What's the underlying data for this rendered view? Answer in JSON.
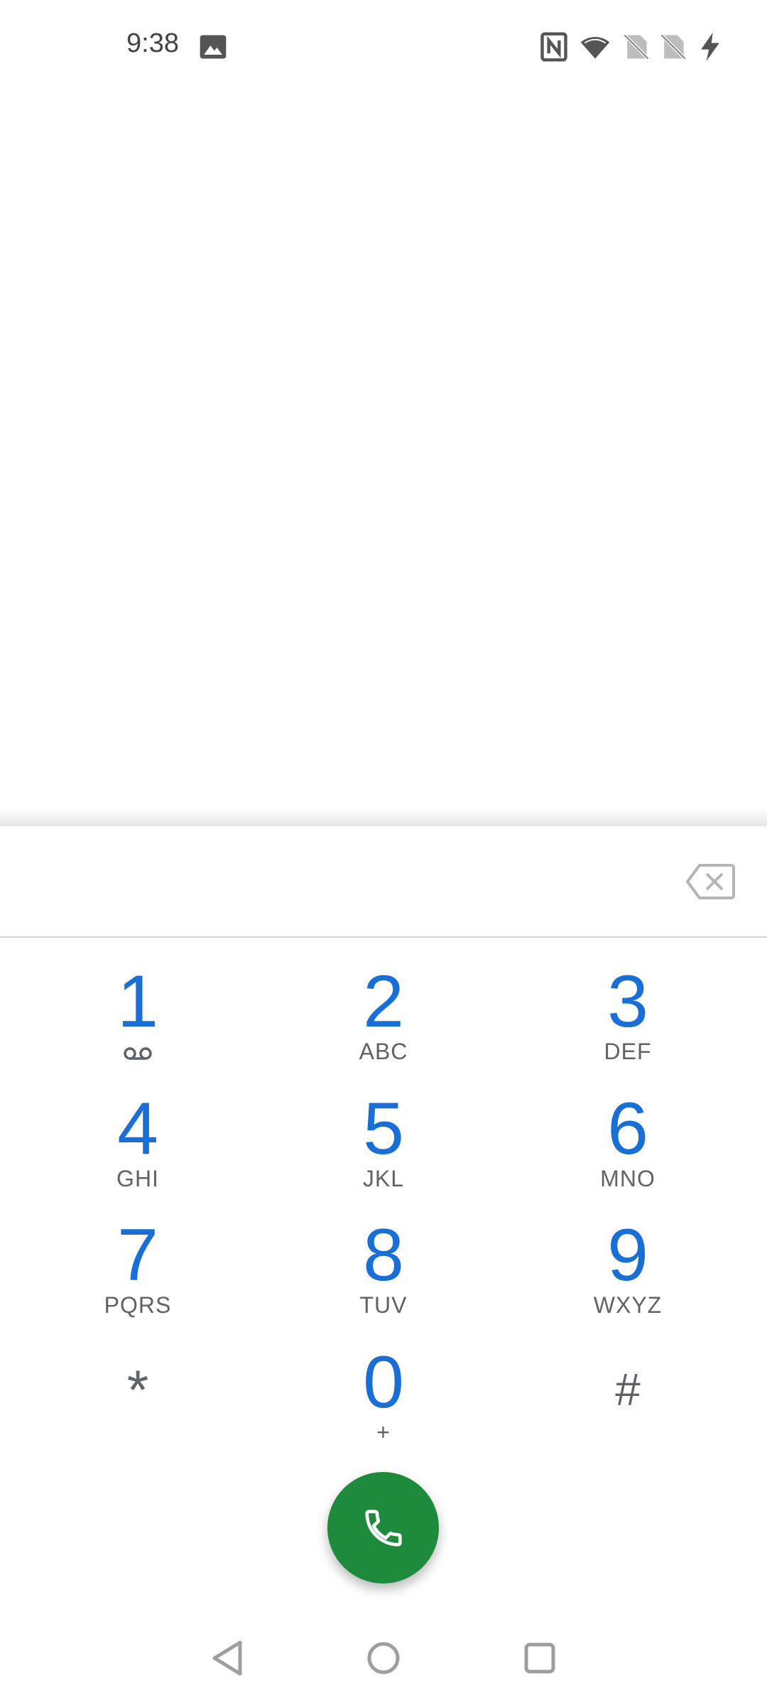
{
  "status_bar": {
    "time": "9:38",
    "icons": [
      "image-icon",
      "nfc-icon",
      "wifi-icon",
      "no-sim-icon",
      "no-sim-icon",
      "charging-icon"
    ]
  },
  "dial_field": {
    "value": "",
    "backspace_icon": "backspace-icon"
  },
  "keypad": {
    "keys": [
      {
        "digit": "1",
        "letters": "",
        "icon": "voicemail-icon"
      },
      {
        "digit": "2",
        "letters": "ABC"
      },
      {
        "digit": "3",
        "letters": "DEF"
      },
      {
        "digit": "4",
        "letters": "GHI"
      },
      {
        "digit": "5",
        "letters": "JKL"
      },
      {
        "digit": "6",
        "letters": "MNO"
      },
      {
        "digit": "7",
        "letters": "PQRS"
      },
      {
        "digit": "8",
        "letters": "TUV"
      },
      {
        "digit": "9",
        "letters": "WXYZ"
      },
      {
        "symbol": "*"
      },
      {
        "digit": "0",
        "letters": "+"
      },
      {
        "symbol": "#"
      }
    ]
  },
  "call_button": {
    "icon": "phone-icon",
    "color": "#1e8a3c"
  },
  "colors": {
    "digit": "#1a6fd6",
    "letters": "#5f6368"
  },
  "nav_bar": {
    "buttons": [
      "back-icon",
      "home-icon",
      "recents-icon"
    ]
  }
}
